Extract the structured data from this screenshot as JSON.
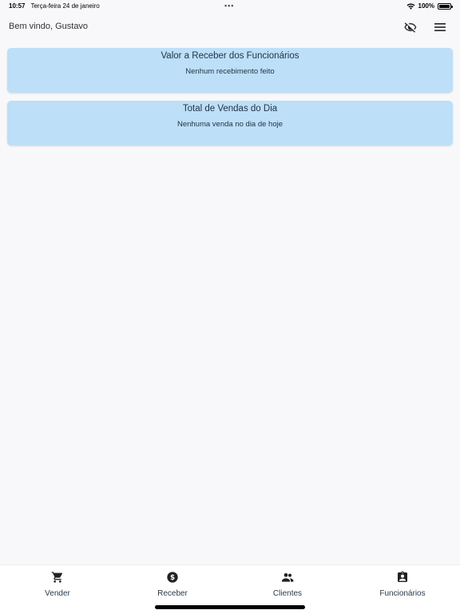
{
  "status_bar": {
    "time": "10:57",
    "date": "Terça-feira 24 de janeiro",
    "dots": "•••",
    "battery": "100%"
  },
  "header": {
    "greeting": "Bem vindo, Gustavo",
    "icons": [
      "eye-off-icon",
      "menu-icon"
    ]
  },
  "cards": {
    "recebimentos": {
      "title": "Valor a Receber dos Funcionários",
      "subtitle": "Nenhum recebimento feito"
    },
    "vendas": {
      "title": "Total de Vendas do Dia",
      "subtitle": "Nenhuma venda no dia de hoje"
    }
  },
  "colors": {
    "card_background": "#bddff7",
    "page_background": "#f8f8fa",
    "text": "#1e3246"
  },
  "bottom_nav": {
    "items": [
      {
        "label": "Vender",
        "icon": "cart-icon"
      },
      {
        "label": "Receber",
        "icon": "dollar-circle-icon"
      },
      {
        "label": "Clientes",
        "icon": "people-icon"
      },
      {
        "label": "Funcionários",
        "icon": "badge-icon"
      }
    ]
  }
}
